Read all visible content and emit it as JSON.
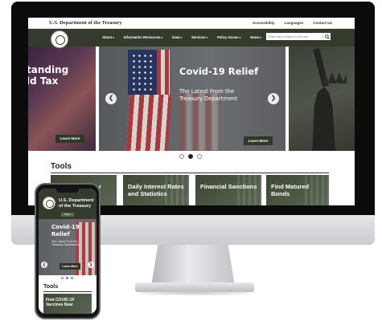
{
  "desktop": {
    "agency_name": "U.S. Department of the Treasury",
    "utility_links": [
      "Accessibility",
      "Languages",
      "Contact Us"
    ],
    "nav_items": [
      "About",
      "Information Resources",
      "Data",
      "Services",
      "Policy Issues",
      "News"
    ],
    "search_placeholder": "Enter text to search on the site",
    "left_slide_text": "tanding\nld Tax",
    "left_slide_button": "Learn More",
    "hero_title": "Covid-19 Relief",
    "hero_subtitle": "The Latest From the Treasury Department",
    "hero_button": "Learn More",
    "carousel_dots": 3,
    "carousel_active_index": 1,
    "tools_heading": "Tools",
    "tool_cards": [
      "r",
      "Daily Interest Rates and Statistics",
      "Financial Sanctions",
      "Find Matured Bonds"
    ]
  },
  "mobile": {
    "agency_name": "U.S. Department of the Treasury",
    "menu_label": "Menu",
    "hero_title": "Covid-19 Relief",
    "hero_subtitle": "The Latest From the Treasury Department",
    "hero_button": "Learn More",
    "tools_heading": "Tools",
    "tool_card": "Find COVID-19 Vaccines Near"
  },
  "colors": {
    "nav_green": "#343a2c",
    "button_green": "#2f3726",
    "card_green": "#3d4733"
  },
  "icons": [
    "search-icon",
    "chevron-left-icon",
    "chevron-right-icon",
    "treasury-seal-icon"
  ]
}
